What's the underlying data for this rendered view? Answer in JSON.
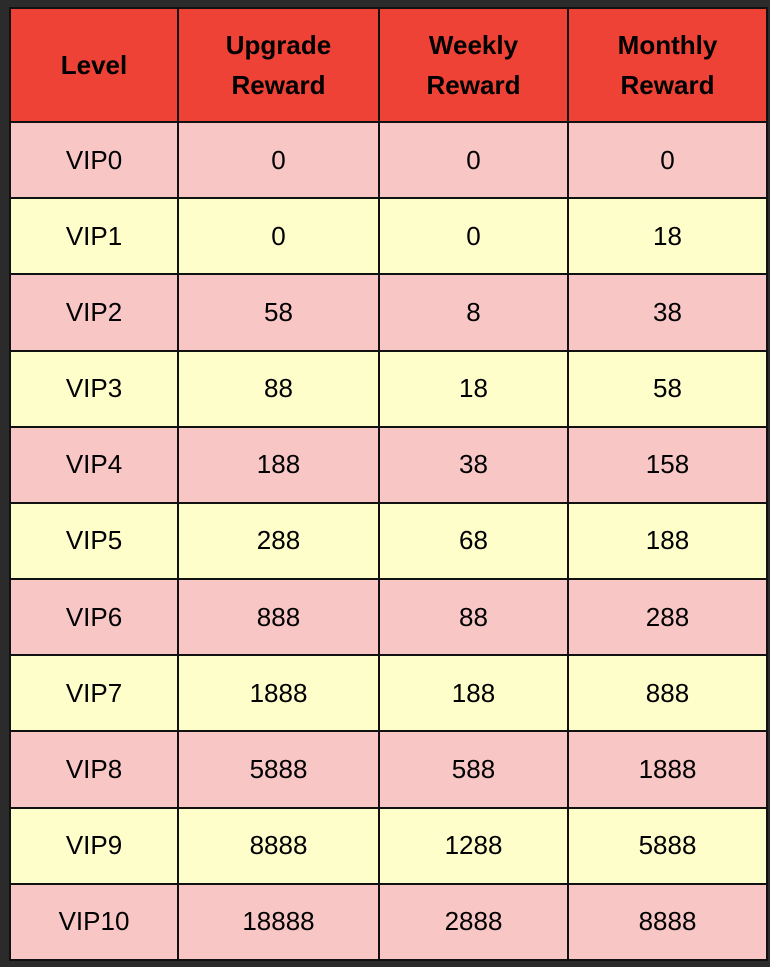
{
  "table": {
    "headers": [
      "Level",
      "Upgrade\nReward",
      "Weekly\nReward",
      "Monthly\nReward"
    ],
    "header_lines": [
      [
        "Level"
      ],
      [
        "Upgrade",
        "Reward"
      ],
      [
        "Weekly",
        "Reward"
      ],
      [
        "Monthly",
        "Reward"
      ]
    ],
    "rows": [
      [
        "VIP0",
        "0",
        "0",
        "0"
      ],
      [
        "VIP1",
        "0",
        "0",
        "18"
      ],
      [
        "VIP2",
        "58",
        "8",
        "38"
      ],
      [
        "VIP3",
        "88",
        "18",
        "58"
      ],
      [
        "VIP4",
        "188",
        "38",
        "158"
      ],
      [
        "VIP5",
        "288",
        "68",
        "188"
      ],
      [
        "VIP6",
        "888",
        "88",
        "288"
      ],
      [
        "VIP7",
        "1888",
        "188",
        "888"
      ],
      [
        "VIP8",
        "5888",
        "588",
        "1888"
      ],
      [
        "VIP9",
        "8888",
        "1288",
        "5888"
      ],
      [
        "VIP10",
        "18888",
        "2888",
        "8888"
      ]
    ]
  },
  "colors": {
    "header_bg": "#ee4236",
    "row_odd_bg": "#f9c6c6",
    "row_even_bg": "#fefecb",
    "frame_bg": "#2b2b2b",
    "border": "#111111"
  }
}
